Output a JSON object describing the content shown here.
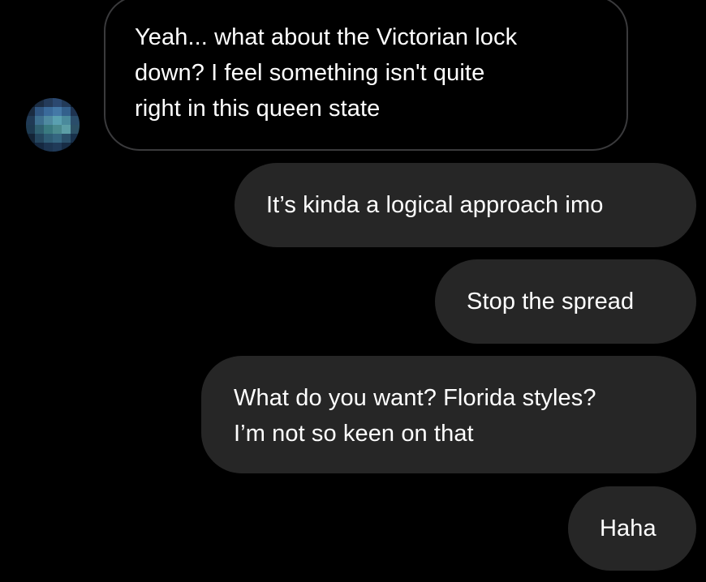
{
  "conversation": {
    "contact": {
      "avatar_icon": "blurred-profile-photo"
    },
    "messages": [
      {
        "direction": "incoming",
        "text": "Yeah... what about the Victorian lock\ndown? I feel something isn't quite\nright in this queen state"
      },
      {
        "direction": "outgoing",
        "text": "It’s kinda a logical approach imo"
      },
      {
        "direction": "outgoing",
        "text": "Stop the spread"
      },
      {
        "direction": "outgoing",
        "text": "What do you want? Florida styles?\nI’m not so keen on that"
      },
      {
        "direction": "outgoing",
        "text": "Haha"
      }
    ]
  },
  "colors": {
    "background": "#000000",
    "outgoing_bubble": "#262626",
    "incoming_border": "#3a3a3c",
    "text": "#ffffff"
  }
}
